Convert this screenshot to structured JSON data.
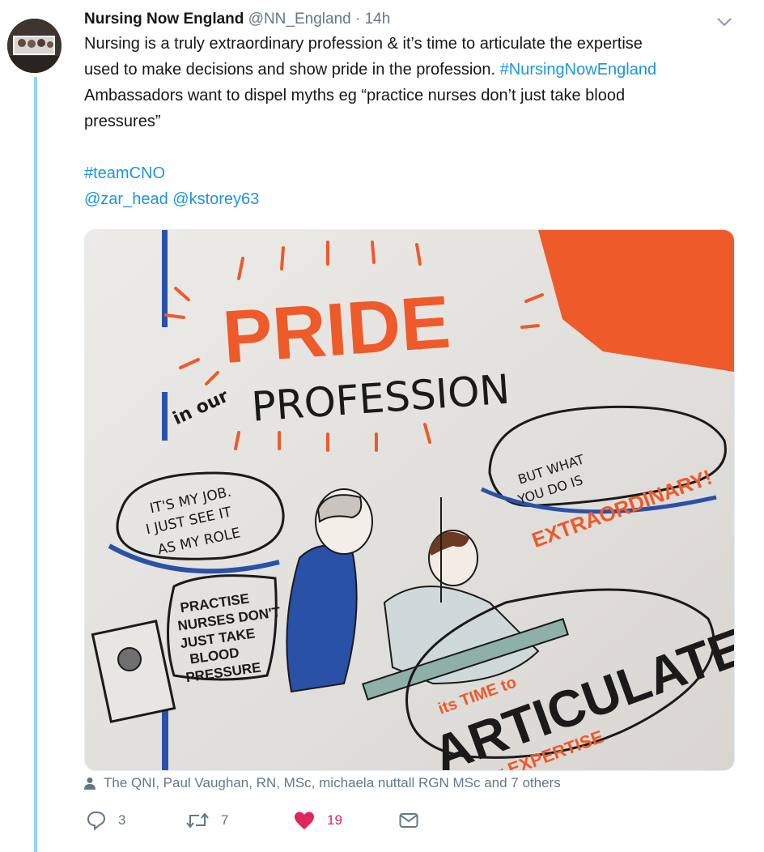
{
  "tweet": {
    "author_name": "Nursing Now England",
    "handle": "@NN_England",
    "separator": "·",
    "time": "14h",
    "text_lines": [
      "Nursing is a truly extraordinary profession & it’s time to articulate the expertise",
      "used to make decisions and show pride in the profession."
    ],
    "hashtag_inline": "#NursingNowEngland",
    "text_line3": "Ambassadors want to dispel myths eg “practice nurses don’t just take blood",
    "text_line4": "pressures”",
    "hashtag_team": "#teamCNO",
    "mention_1": "@zar_head",
    "mention_2": "@kstorey63"
  },
  "media_text": {
    "pride": "PRIDE",
    "in_our": "in our",
    "profession": "PROFESSION",
    "bubble_left": [
      "IT'S MY JOB.",
      "I JUST SEE IT",
      "AS MY ROLE"
    ],
    "bubble_right_1": [
      "BUT WHAT",
      "YOU DO IS"
    ],
    "bubble_right_2": "EXTRAORDINARY!",
    "practise": [
      "PRACTISE",
      "NURSES DON'T",
      "JUST TAKE",
      "BLOOD",
      "PRESSURE"
    ],
    "its_time_to": "its TIME to",
    "articulate": "ARTICULATE",
    "our_expertise": "our EXPERTISE"
  },
  "likers": "The QNI, Paul Vaughan, RN, MSc, michaela nuttall RGN MSc and 7 others",
  "actions": {
    "replies": "3",
    "retweets": "7",
    "likes": "19"
  },
  "colors": {
    "link": "#1b95e0",
    "like": "#e0245e",
    "muted": "#657786",
    "thread": "#9ad4f5",
    "poster_orange": "#ee5a2a",
    "poster_blue": "#2a51a8"
  },
  "icons": {
    "reply": "reply-icon",
    "retweet": "retweet-icon",
    "like": "heart-icon",
    "dm": "envelope-icon",
    "caret": "chevron-down-icon",
    "likers": "person-icon"
  }
}
